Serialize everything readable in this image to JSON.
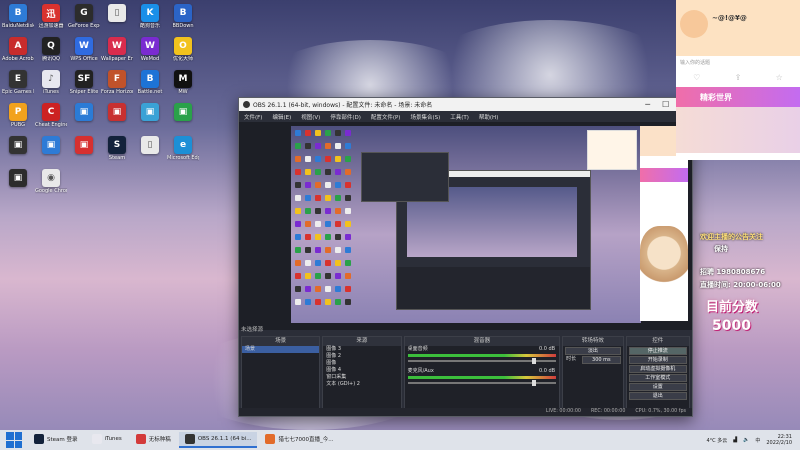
{
  "desktop_icons": [
    {
      "label": "BaiduNetdisk",
      "color": "#2e7bd6",
      "glyph": "B"
    },
    {
      "label": "迅游加速器",
      "color": "#d8322e",
      "glyph": "迅"
    },
    {
      "label": "GeForce Experience",
      "color": "#2c2c2c",
      "glyph": "G"
    },
    {
      "label": "",
      "color": "#e9e9e9",
      "glyph": "▯"
    },
    {
      "label": "酷狗音乐",
      "color": "#1a8fe8",
      "glyph": "K"
    },
    {
      "label": "BBDown",
      "color": "#2b64c7",
      "glyph": "B"
    },
    {
      "label": "Adobe Acrobat",
      "color": "#c82c2c",
      "glyph": "A"
    },
    {
      "label": "腾讯QQ",
      "color": "#222",
      "glyph": "Q"
    },
    {
      "label": "WPS Office",
      "color": "#2f6be0",
      "glyph": "W"
    },
    {
      "label": "Wallpaper Engine",
      "color": "#d92c4d",
      "glyph": "W"
    },
    {
      "label": "WeMod",
      "color": "#7a2bd1",
      "glyph": "W"
    },
    {
      "label": "优化大师",
      "color": "#f2c21d",
      "glyph": "O"
    },
    {
      "label": "Epic Games Launcher",
      "color": "#333",
      "glyph": "E"
    },
    {
      "label": "iTunes",
      "color": "#e7e7ef",
      "glyph": "♪"
    },
    {
      "label": "Sniper Elite",
      "color": "#222",
      "glyph": "SF"
    },
    {
      "label": "Forza Horizon",
      "color": "#c1522a",
      "glyph": "F"
    },
    {
      "label": "Battle.net",
      "color": "#1d73d6",
      "glyph": "B"
    },
    {
      "label": "MW",
      "color": "#111",
      "glyph": "M"
    },
    {
      "label": "PUBG",
      "color": "#f2a21d",
      "glyph": "P"
    },
    {
      "label": "Cheat Engine",
      "color": "#c22",
      "glyph": "C"
    },
    {
      "label": "",
      "color": "#2b7bd6",
      "glyph": "▣"
    },
    {
      "label": "",
      "color": "#c83030",
      "glyph": "▣"
    },
    {
      "label": "",
      "color": "#3aa2d6",
      "glyph": "▣"
    },
    {
      "label": "",
      "color": "#2aa14a",
      "glyph": "▣"
    },
    {
      "label": "",
      "color": "#333",
      "glyph": "▣"
    },
    {
      "label": "",
      "color": "#2e7bd6",
      "glyph": "▣"
    },
    {
      "label": "",
      "color": "#d63030",
      "glyph": "▣"
    },
    {
      "label": "Steam",
      "color": "#13223b",
      "glyph": "S"
    },
    {
      "label": "",
      "color": "#e9e9e9",
      "glyph": "▯"
    },
    {
      "label": "Microsoft Edge",
      "color": "#1d8fd6",
      "glyph": "e"
    },
    {
      "label": "",
      "color": "#2c2c2c",
      "glyph": "▣"
    },
    {
      "label": "Google Chrome",
      "color": "#e9e9e9",
      "glyph": "◉"
    }
  ],
  "obs": {
    "title": "OBS 26.1.1 (64-bit, windows) - 配置文件: 未命名 - 场景: 未命名",
    "menu": [
      "文件(F)",
      "编辑(E)",
      "视图(V)",
      "停靠部件(D)",
      "配置文件(P)",
      "场景集合(S)",
      "工具(T)",
      "帮助(H)"
    ],
    "preview_label": "未选择源",
    "docks": {
      "scenes": {
        "title": "场景",
        "items": [
          "场景"
        ]
      },
      "sources": {
        "title": "来源",
        "items": [
          "图像 3",
          "图像 2",
          "图像",
          "图像 4",
          "窗口采集",
          "文本 (GDI+) 2"
        ]
      },
      "mixer": {
        "title": "混音器",
        "channels": [
          {
            "name": "桌面音频",
            "db": "0.0 dB"
          },
          {
            "name": "麦克风/Aux",
            "db": "0.0 dB"
          }
        ]
      },
      "transitions": {
        "title": "转场特效",
        "items": [
          "淡出",
          "时长",
          "300 ms"
        ]
      },
      "controls": {
        "title": "控件",
        "buttons": [
          "停止推流",
          "开始录制",
          "启动虚拟摄像机",
          "工作室模式",
          "设置",
          "退出"
        ]
      }
    },
    "status": [
      "LIVE: 00:00:00",
      "REC: 00:00:00",
      "CPU: 0.7%, 30.00 fps"
    ]
  },
  "live_panel": {
    "streamer": "~@!@¥@",
    "input_placeholder": "输入你的话题",
    "banner": "精彩世界"
  },
  "overlay": {
    "notice": "欢迎主播的公告关注",
    "line1": "保持",
    "line2": "招聘 1980808676",
    "line3": "直播时间: 20:00-06:00",
    "score_label": "目前分数",
    "score_value": "5000"
  },
  "taskbar": {
    "items": [
      {
        "label": "Steam 登录",
        "color": "#13223b",
        "active": false
      },
      {
        "label": "iTunes",
        "color": "#e8e8ef",
        "active": false
      },
      {
        "label": "无标种稿",
        "color": "#d33a3a",
        "active": false
      },
      {
        "label": "OBS 26.1.1 (64 bi...",
        "color": "#333",
        "active": true
      },
      {
        "label": "猎七七7000直播_今...",
        "color": "#e26b2a",
        "active": false
      }
    ],
    "weather": "4°C 多云",
    "time": "22:31",
    "date": "2022/2/10",
    "lang": "中"
  }
}
